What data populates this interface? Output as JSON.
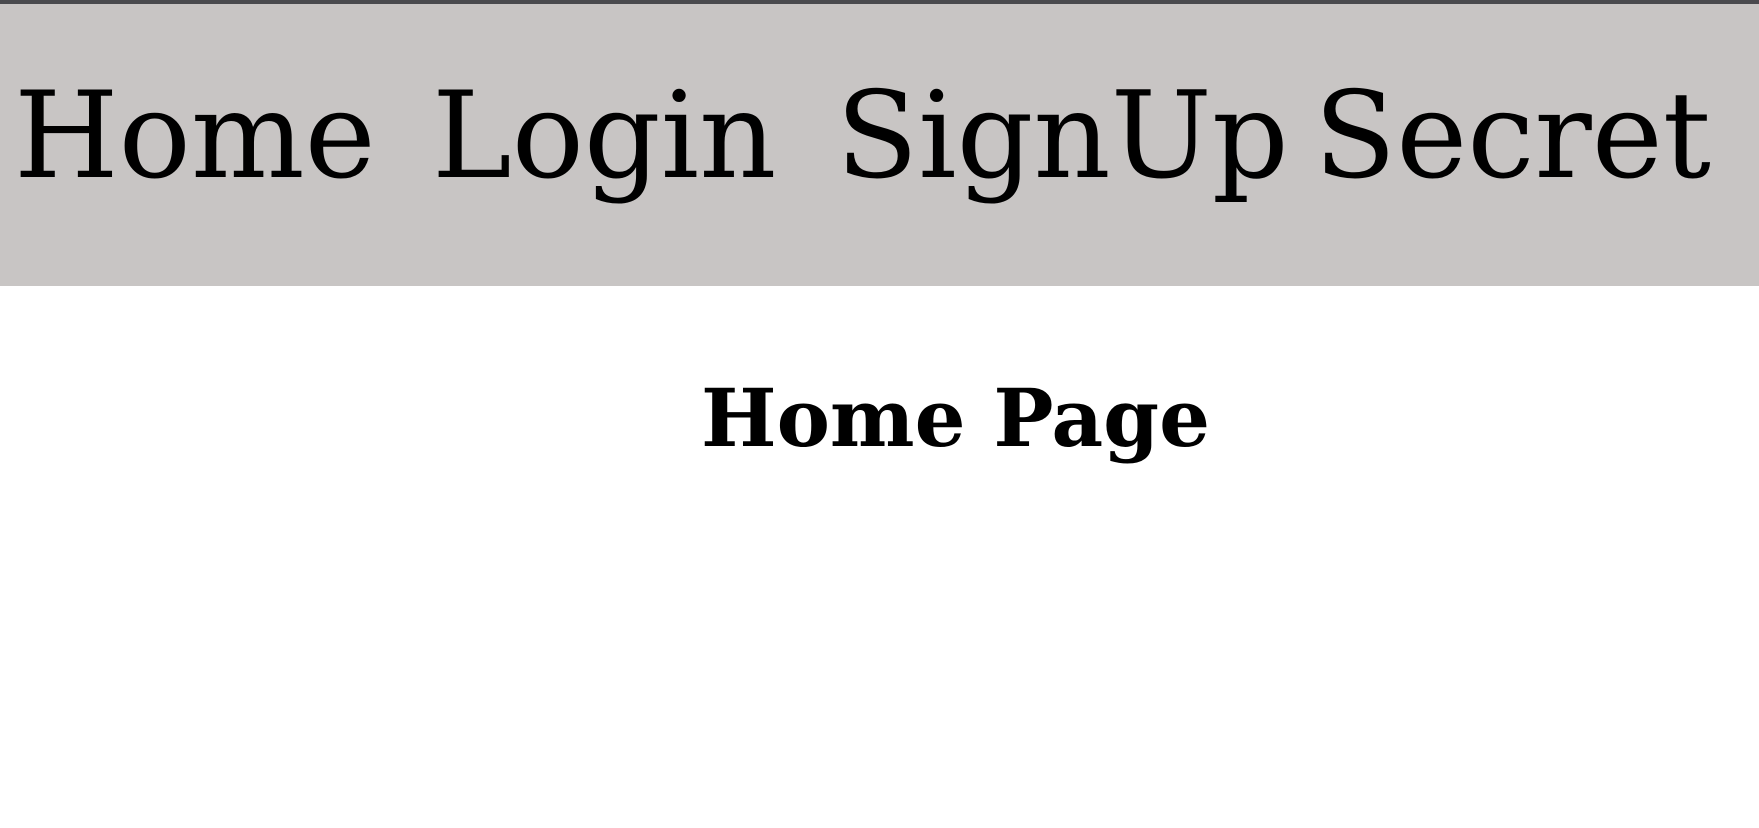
{
  "nav": {
    "items": [
      {
        "label": "Home"
      },
      {
        "label": "Login"
      },
      {
        "label": "SignUp"
      },
      {
        "label": "Secret"
      }
    ]
  },
  "main": {
    "title": "Home Page"
  },
  "colors": {
    "navbar_background": "#c8c5c4",
    "top_edge": "#4a4a4e",
    "page_background": "#ffffff",
    "text": "#000000"
  }
}
